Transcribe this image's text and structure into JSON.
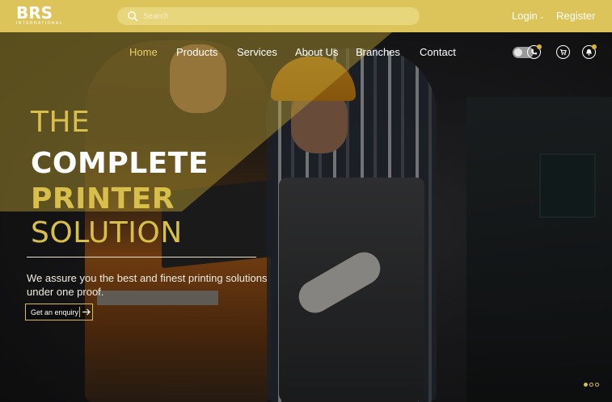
{
  "brand": {
    "logo_text": "BRS",
    "logo_subtext": "INTERNATIONAL"
  },
  "search": {
    "placeholder": "Search"
  },
  "auth": {
    "login_label": "Login",
    "register_label": "Register"
  },
  "nav": {
    "items": [
      {
        "label": "Home",
        "active": true
      },
      {
        "label": "Products",
        "active": false
      },
      {
        "label": "Services",
        "active": false
      },
      {
        "label": "About Us",
        "active": false
      },
      {
        "label": "Branches",
        "active": false
      },
      {
        "label": "Contact",
        "active": false
      }
    ]
  },
  "utility_icons": [
    "theme-toggle",
    "phone-icon",
    "cart-icon",
    "bell-icon"
  ],
  "hero": {
    "line1": "THE",
    "line2": "COMPLETE",
    "line3": "PRINTER",
    "line4": "SOLUTION",
    "description": "We assure you the best and finest printing solutions under one proof.",
    "cta_label": "Get an enquiry"
  },
  "carousel": {
    "total": 3,
    "active_index": 0
  },
  "colors": {
    "accent": "#dcc35a",
    "accent_text": "#d8bf4c",
    "active_nav": "#e9d06a"
  }
}
